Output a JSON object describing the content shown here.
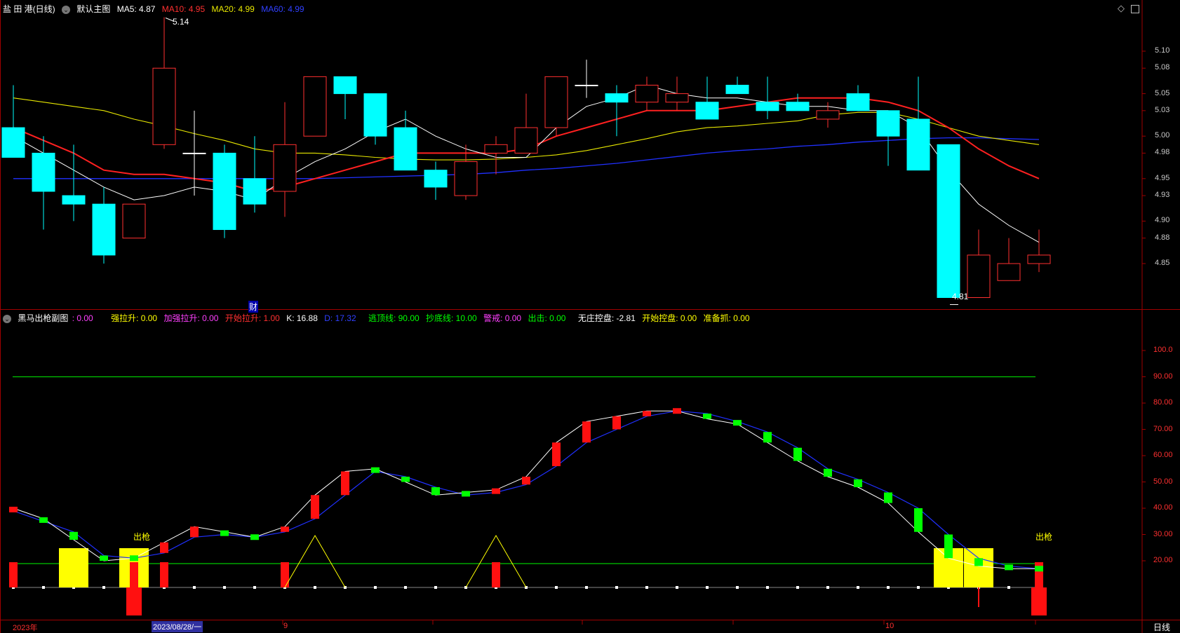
{
  "header_main": {
    "security": "盐 田 港(日线)",
    "indicator": "默认主图",
    "ma5": "MA5: 4.87",
    "ma10": "MA10: 4.95",
    "ma20": "MA20: 4.99",
    "ma60": "MA60: 4.99"
  },
  "header_sub": {
    "name": "黑马出枪副图",
    "name_value": ": 0.00",
    "qianglasheng": "强拉升: 0.00",
    "jiaqianglasheng": "加强拉升: 0.00",
    "kaishilasheng": "开始拉升: 1.00",
    "k": "K: 16.88",
    "d": "D: 17.32",
    "taodingxian": "逃顶线: 90.00",
    "chaodixian": "抄底线: 10.00",
    "jingjie": "警戒: 0.00",
    "chuji": "出击: 0.00",
    "wuzhuangkongpan": "无庄控盘: -2.81",
    "kaishikongpan": "开始控盘: 0.00",
    "zhunbeizhua": "准备抓: 0.00"
  },
  "colors": {
    "up": "#ff3030",
    "down": "#00ffff",
    "ma5": "#ffffff",
    "ma10": "#ff2020",
    "ma20": "#e8e800",
    "ma60": "#2030ff",
    "k_line": "#ffffff",
    "d_line": "#2030ff",
    "kd_up": "#ff1010",
    "kd_down": "#00ff00",
    "guide": "#00c800",
    "yellow": "#ffff00",
    "axis": "#a00000"
  },
  "bottom_axis": {
    "year_label": "2023年",
    "cursor_date": "2023/08/28/一",
    "month_9": "9",
    "month_10": "10",
    "period_button": "日线"
  },
  "annotations": {
    "high_price": "5.14",
    "low_price": "4.81",
    "cai_marker": "财",
    "chuqiang_left": "出枪",
    "chuqiang_right": "出枪"
  },
  "chart_data": [
    {
      "type": "candlestick",
      "y_ticks": [
        "5.10",
        "5.08",
        "5.05",
        "5.03",
        "5.00",
        "4.98",
        "4.95",
        "4.93",
        "4.90",
        "4.88",
        "4.85"
      ],
      "ylim": [
        4.805,
        5.155
      ],
      "candles": [
        {
          "o": 5.01,
          "h": 5.06,
          "l": 4.98,
          "c": 4.975
        },
        {
          "o": 4.98,
          "h": 5.0,
          "l": 4.89,
          "c": 4.935
        },
        {
          "o": 4.93,
          "h": 4.99,
          "l": 4.9,
          "c": 4.92
        },
        {
          "o": 4.92,
          "h": 4.94,
          "l": 4.85,
          "c": 4.86
        },
        {
          "o": 4.88,
          "h": 4.92,
          "l": 4.88,
          "c": 4.92
        },
        {
          "o": 4.99,
          "h": 5.14,
          "l": 4.985,
          "c": 5.08
        },
        {
          "o": 4.98,
          "h": 5.03,
          "l": 4.93,
          "c": 4.98
        },
        {
          "o": 4.98,
          "h": 4.99,
          "l": 4.88,
          "c": 4.89
        },
        {
          "o": 4.95,
          "h": 5.0,
          "l": 4.91,
          "c": 4.92
        },
        {
          "o": 4.935,
          "h": 5.04,
          "l": 4.905,
          "c": 4.99
        },
        {
          "o": 5.0,
          "h": 5.07,
          "l": 5.0,
          "c": 5.07
        },
        {
          "o": 5.07,
          "h": 5.07,
          "l": 5.02,
          "c": 5.05
        },
        {
          "o": 5.05,
          "h": 5.05,
          "l": 4.99,
          "c": 5.0
        },
        {
          "o": 5.01,
          "h": 5.03,
          "l": 4.96,
          "c": 4.96
        },
        {
          "o": 4.96,
          "h": 4.97,
          "l": 4.925,
          "c": 4.94
        },
        {
          "o": 4.93,
          "h": 4.99,
          "l": 4.925,
          "c": 4.97
        },
        {
          "o": 4.98,
          "h": 5.0,
          "l": 4.955,
          "c": 4.99
        },
        {
          "o": 4.98,
          "h": 5.05,
          "l": 4.98,
          "c": 5.01
        },
        {
          "o": 5.01,
          "h": 5.07,
          "l": 5.0,
          "c": 5.07
        },
        {
          "o": 5.06,
          "h": 5.09,
          "l": 5.045,
          "c": 5.06
        },
        {
          "o": 5.05,
          "h": 5.06,
          "l": 5.0,
          "c": 5.04
        },
        {
          "o": 5.04,
          "h": 5.07,
          "l": 5.03,
          "c": 5.06
        },
        {
          "o": 5.04,
          "h": 5.07,
          "l": 5.03,
          "c": 5.05
        },
        {
          "o": 5.04,
          "h": 5.07,
          "l": 5.02,
          "c": 5.02
        },
        {
          "o": 5.06,
          "h": 5.07,
          "l": 5.05,
          "c": 5.05
        },
        {
          "o": 5.04,
          "h": 5.07,
          "l": 5.02,
          "c": 5.03
        },
        {
          "o": 5.04,
          "h": 5.05,
          "l": 5.03,
          "c": 5.03
        },
        {
          "o": 5.02,
          "h": 5.04,
          "l": 5.01,
          "c": 5.03
        },
        {
          "o": 5.05,
          "h": 5.06,
          "l": 5.03,
          "c": 5.03
        },
        {
          "o": 5.03,
          "h": 5.03,
          "l": 4.965,
          "c": 5.0
        },
        {
          "o": 5.02,
          "h": 5.07,
          "l": 4.96,
          "c": 4.96
        },
        {
          "o": 4.99,
          "h": 4.99,
          "l": 4.81,
          "c": 4.81
        },
        {
          "o": 4.81,
          "h": 4.89,
          "l": 4.81,
          "c": 4.86
        },
        {
          "o": 4.83,
          "h": 4.88,
          "l": 4.83,
          "c": 4.85
        },
        {
          "o": 4.85,
          "h": 4.89,
          "l": 4.84,
          "c": 4.86
        }
      ],
      "ma5": [
        5.0,
        4.98,
        4.96,
        4.94,
        4.925,
        4.93,
        4.94,
        4.935,
        4.925,
        4.95,
        4.97,
        4.985,
        5.005,
        5.02,
        5.0,
        4.985,
        4.975,
        4.975,
        5.01,
        5.035,
        5.045,
        5.06,
        5.05,
        5.045,
        5.045,
        5.04,
        5.035,
        5.035,
        5.03,
        5.03,
        5.01,
        4.96,
        4.92,
        4.895,
        4.875
      ],
      "ma10": [
        5.01,
        4.995,
        4.98,
        4.96,
        4.955,
        4.955,
        4.95,
        4.945,
        4.935,
        4.94,
        4.95,
        4.96,
        4.97,
        4.98,
        4.98,
        4.98,
        4.98,
        4.985,
        5.0,
        5.01,
        5.02,
        5.03,
        5.03,
        5.03,
        5.035,
        5.04,
        5.045,
        5.045,
        5.045,
        5.04,
        5.03,
        5.01,
        4.985,
        4.965,
        4.95
      ],
      "ma20": [
        5.045,
        5.04,
        5.035,
        5.03,
        5.02,
        5.012,
        5.003,
        4.995,
        4.985,
        4.98,
        4.98,
        4.978,
        4.975,
        4.973,
        4.972,
        4.972,
        4.973,
        4.975,
        4.978,
        4.983,
        4.99,
        4.997,
        5.005,
        5.01,
        5.012,
        5.015,
        5.018,
        5.025,
        5.028,
        5.028,
        5.02,
        5.01,
        5.0,
        4.995,
        4.99
      ],
      "ma60": [
        4.95,
        4.95,
        4.95,
        4.95,
        4.95,
        4.95,
        4.95,
        4.95,
        4.95,
        4.95,
        4.95,
        4.951,
        4.952,
        4.953,
        4.954,
        4.955,
        4.957,
        4.96,
        4.962,
        4.965,
        4.968,
        4.972,
        4.976,
        4.98,
        4.983,
        4.985,
        4.988,
        4.99,
        4.993,
        4.995,
        4.997,
        4.998,
        4.998,
        4.997,
        4.996
      ]
    },
    {
      "type": "indicator",
      "y_ticks": [
        "100.0",
        "90.00",
        "80.00",
        "70.00",
        "60.00",
        "50.00",
        "40.00",
        "30.00",
        "20.00"
      ],
      "ylim": [
        -21,
        102
      ],
      "guide_levels": [
        90,
        10
      ],
      "K": [
        40,
        36,
        28,
        20,
        21,
        27,
        33,
        31,
        29,
        33,
        45,
        54,
        55,
        50,
        45,
        46,
        47,
        52,
        65,
        73,
        75,
        77,
        77,
        74,
        72,
        65,
        58,
        52,
        48,
        42,
        31,
        21,
        18,
        17,
        17
      ],
      "D": [
        39,
        35,
        31,
        22,
        21,
        23,
        29,
        30,
        29,
        31,
        36,
        45,
        54,
        52,
        48,
        45,
        46,
        49,
        56,
        65,
        70,
        75,
        77,
        76,
        73,
        69,
        63,
        55,
        51,
        46,
        40,
        30,
        21,
        18,
        17
      ],
      "bars": [
        1,
        -1,
        -1,
        -1,
        -1,
        1,
        1,
        -1,
        -1,
        1,
        1,
        1,
        -1,
        -1,
        -1,
        -1,
        1,
        1,
        1,
        1,
        1,
        1,
        1,
        -1,
        -1,
        -1,
        -1,
        -1,
        -1,
        -1,
        -1,
        -1,
        -1,
        -1,
        -1
      ],
      "red_signal": [
        10,
        0,
        0,
        0,
        10,
        10,
        0,
        0,
        0,
        10,
        0,
        0,
        0,
        0,
        0,
        0,
        10,
        0,
        0,
        0,
        0,
        0,
        0,
        0,
        0,
        0,
        0,
        0,
        0,
        0,
        0,
        0,
        0,
        0,
        10
      ],
      "red_negative": [
        0,
        0,
        0,
        0,
        -10,
        0,
        0,
        0,
        0,
        0,
        0,
        0,
        0,
        0,
        0,
        0,
        0,
        0,
        0,
        0,
        0,
        0,
        0,
        0,
        0,
        0,
        0,
        0,
        0,
        0,
        0,
        0,
        -8,
        0,
        -10
      ],
      "yellow_blocks": [
        0,
        0,
        15,
        0,
        15,
        0,
        0,
        0,
        0,
        0,
        0,
        0,
        0,
        0,
        0,
        0,
        0,
        0,
        0,
        0,
        0,
        0,
        0,
        0,
        0,
        0,
        0,
        0,
        0,
        0,
        0,
        15,
        15,
        0,
        0
      ],
      "triangles": [
        10,
        16
      ],
      "triangle_height": 20
    }
  ]
}
